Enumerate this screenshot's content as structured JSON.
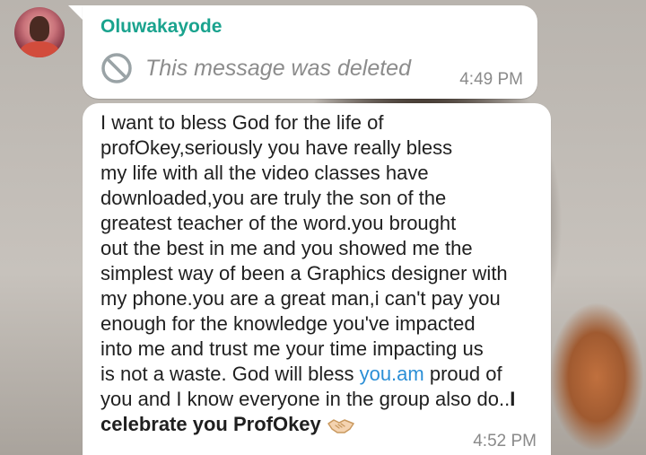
{
  "chat": {
    "avatar_icon": "contact-avatar",
    "deleted_message": {
      "sender": "Oluwakayode",
      "text": "This message was deleted",
      "icon": "ban-icon",
      "time": "4:49 PM",
      "sender_color": "#1aa38e"
    },
    "message": {
      "text_part1": "I want to bless God for the life of\nprofOkey,seriously you have really bless\nmy life with all the video classes have\ndownloaded,you are truly the son of the\ngreatest teacher of the word.you brought\nout the best in me and you showed me the\nsimplest way of been a Graphics designer with\nmy phone.you are a great man,i can't pay you\nenough for the knowledge you've impacted\ninto me and trust me your time impacting us\nis not a waste. God will bless ",
      "link_text": "you.am",
      "text_part2": " proud of\nyou and I know everyone in the group also do..",
      "bold_start": "I",
      "bold_end": "celebrate you ProfOkey",
      "emoji_icon": "handshake-icon",
      "time": "4:52 PM",
      "link_color": "#2b8fd6"
    }
  }
}
